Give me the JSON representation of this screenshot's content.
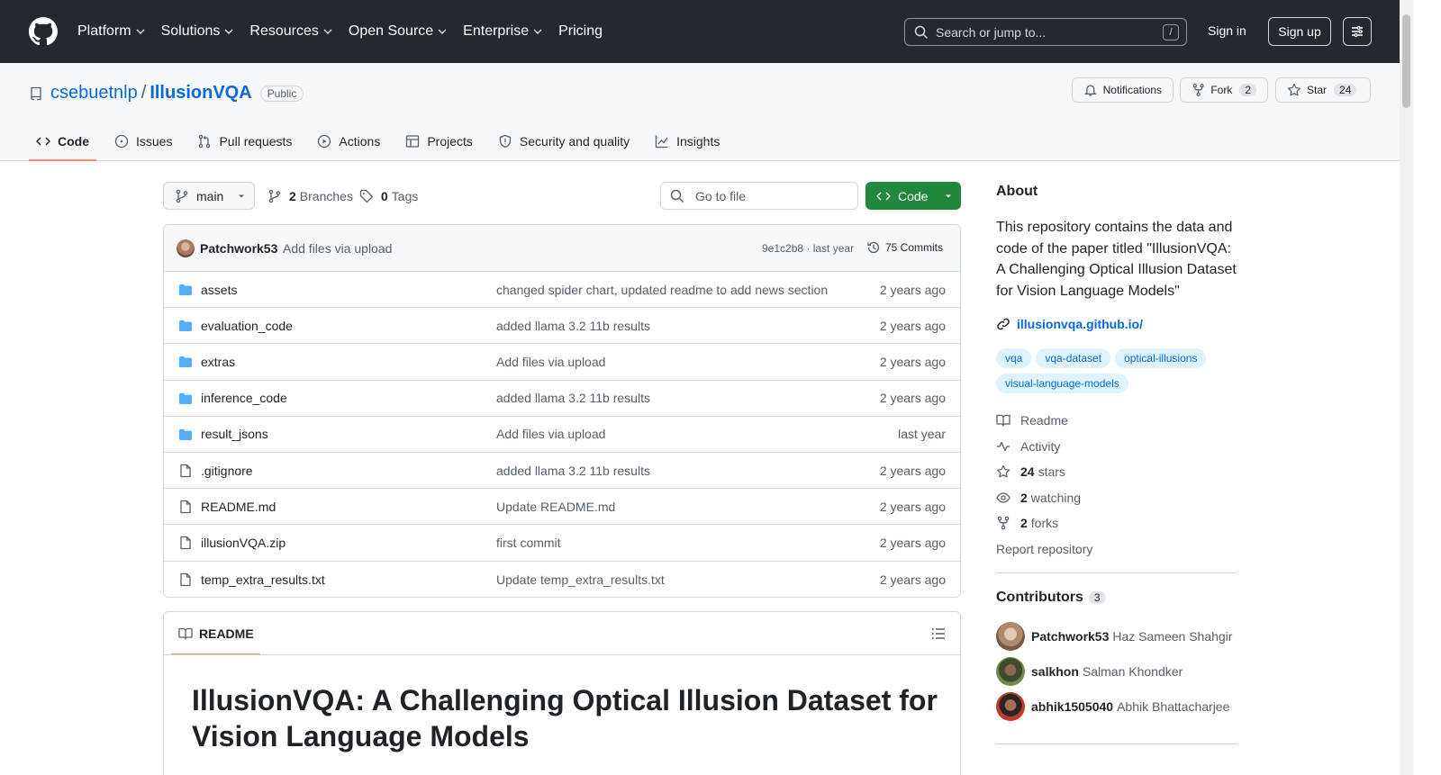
{
  "header": {
    "nav": [
      {
        "label": "Platform"
      },
      {
        "label": "Solutions"
      },
      {
        "label": "Resources"
      },
      {
        "label": "Open Source"
      },
      {
        "label": "Enterprise"
      },
      {
        "label": "Pricing"
      }
    ],
    "search_placeholder": "Search or jump to...",
    "search_shortcut": "/",
    "signin": "Sign in",
    "signup": "Sign up"
  },
  "repo": {
    "owner": "csebuetnlp",
    "separator": "/",
    "name": "IllusionVQA",
    "visibility": "Public",
    "notifications_label": "Notifications",
    "fork_label": "Fork",
    "fork_count": "2",
    "star_label": "Star",
    "star_count": "24"
  },
  "tabs": [
    {
      "label": "Code",
      "icon": "code-icon"
    },
    {
      "label": "Issues",
      "icon": "issue-icon"
    },
    {
      "label": "Pull requests",
      "icon": "pull-request-icon"
    },
    {
      "label": "Actions",
      "icon": "play-icon"
    },
    {
      "label": "Projects",
      "icon": "table-icon"
    },
    {
      "label": "Security and quality",
      "icon": "shield-icon"
    },
    {
      "label": "Insights",
      "icon": "graph-icon"
    }
  ],
  "toolbar": {
    "branch": "main",
    "branches_count": "2",
    "branches_label": "Branches",
    "tags_count": "0",
    "tags_label": "Tags",
    "goto_placeholder": "Go to file",
    "code_label": "Code"
  },
  "commit": {
    "author": "Patchwork53",
    "message": "Add files via upload",
    "hash_time": "9e1c2b8 · last year",
    "count": "75 Commits"
  },
  "files": [
    {
      "name": "assets",
      "type": "folder",
      "message": "changed spider chart, updated readme to add news section",
      "date": "2 years ago"
    },
    {
      "name": "evaluation_code",
      "type": "folder",
      "message": "added llama 3.2 11b results",
      "date": "2 years ago"
    },
    {
      "name": "extras",
      "type": "folder",
      "message": "Add files via upload",
      "date": "2 years ago"
    },
    {
      "name": "inference_code",
      "type": "folder",
      "message": "added llama 3.2 11b results",
      "date": "2 years ago"
    },
    {
      "name": "result_jsons",
      "type": "folder",
      "message": "Add files via upload",
      "date": "last year"
    },
    {
      "name": ".gitignore",
      "type": "file",
      "message": "added llama 3.2 11b results",
      "date": "2 years ago"
    },
    {
      "name": "README.md",
      "type": "file",
      "message": "Update README.md",
      "date": "2 years ago"
    },
    {
      "name": "illusionVQA.zip",
      "type": "file",
      "message": "first commit",
      "date": "2 years ago"
    },
    {
      "name": "temp_extra_results.txt",
      "type": "file",
      "message": "Update temp_extra_results.txt",
      "date": "2 years ago"
    }
  ],
  "readme": {
    "tab_label": "README",
    "heading": "IllusionVQA: A Challenging Optical Illusion Dataset for Vision Language Models"
  },
  "about": {
    "title": "About",
    "description": "This repository contains the data and code of the paper titled \"IllusionVQA: A Challenging Optical Illusion Dataset for Vision Language Models\"",
    "link": "illusionvqa.github.io/",
    "topics": [
      "vqa",
      "vqa-dataset",
      "optical-illusions",
      "visual-language-models"
    ],
    "readme_label": "Readme",
    "activity_label": "Activity",
    "stars_count": "24",
    "stars_label": "stars",
    "watching_count": "2",
    "watching_label": "watching",
    "forks_count": "2",
    "forks_label": "forks",
    "report_label": "Report repository"
  },
  "contributors": {
    "title": "Contributors",
    "count": "3",
    "list": [
      {
        "login": "Patchwork53",
        "name": "Haz Sameen Shahgir"
      },
      {
        "login": "salkhon",
        "name": "Salman Khondker"
      },
      {
        "login": "abhik1505040",
        "name": "Abhik Bhattacharjee"
      }
    ]
  },
  "colors": {
    "header_bg": "#24292f",
    "link": "#0969da",
    "code_button": "#1f883d",
    "tab_underline": "#fd8c73",
    "folder": "#54aeff"
  }
}
